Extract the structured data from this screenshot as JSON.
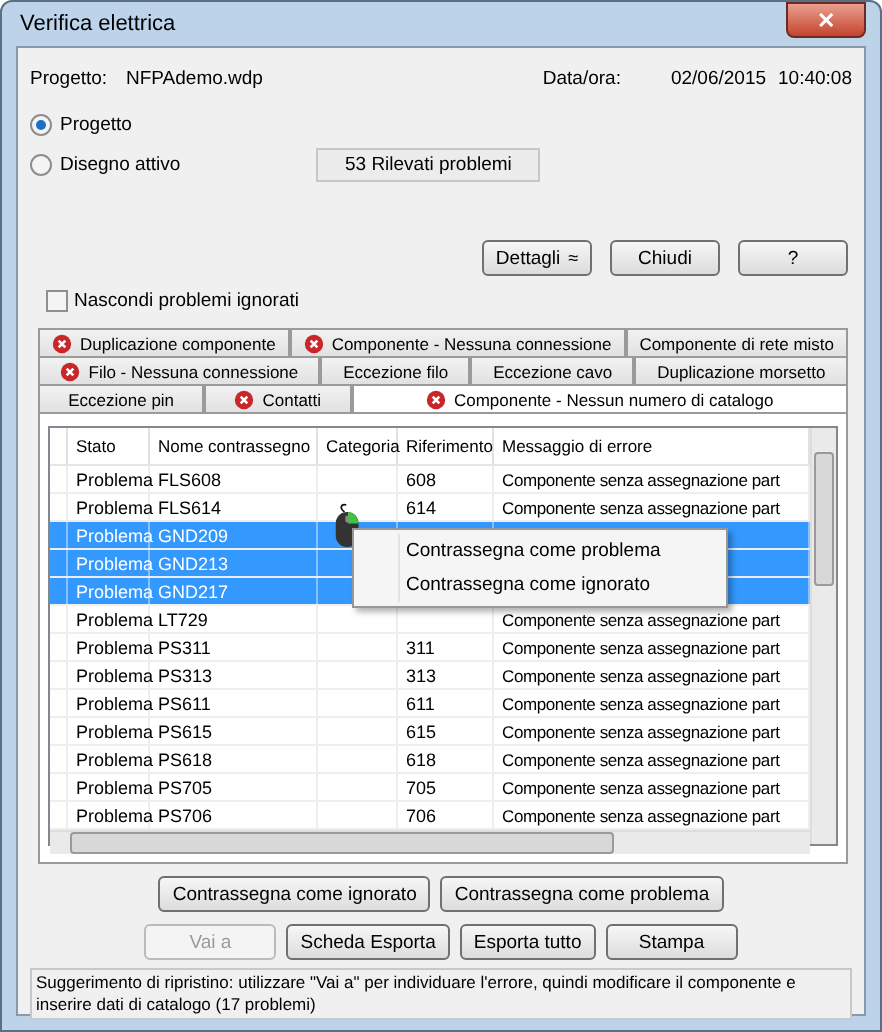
{
  "window": {
    "title": "Verifica elettrica",
    "close": "✕"
  },
  "project": {
    "label": "Progetto:",
    "value": "NFPAdemo.wdp",
    "date_label": "Data/ora:",
    "date": "02/06/2015",
    "time": "10:40:08"
  },
  "scope": [
    {
      "label": "Progetto",
      "selected": true
    },
    {
      "label": "Disegno attivo",
      "selected": false
    }
  ],
  "summary": "53 Rilevati problemi",
  "top_buttons": [
    {
      "label": "Dettagli",
      "kind": "details",
      "icon": "≈"
    },
    {
      "label": "Chiudi",
      "kind": "plain"
    },
    {
      "label": "?",
      "kind": "plain"
    }
  ],
  "hide_ignored": {
    "label": "Nascondi problemi ignorati",
    "checked": false
  },
  "tab_rows": [
    [
      {
        "label": "Duplicazione componente",
        "error": true,
        "selected": false
      },
      {
        "label": "Componente - Nessuna connessione",
        "error": true,
        "selected": false
      },
      {
        "label": "Componente di rete misto",
        "error": false,
        "selected": false
      }
    ],
    [
      {
        "label": "Filo - Nessuna connessione",
        "error": true,
        "selected": false
      },
      {
        "label": "Eccezione filo",
        "error": false,
        "selected": false
      },
      {
        "label": "Eccezione cavo",
        "error": false,
        "selected": false
      },
      {
        "label": "Duplicazione morsetto",
        "error": false,
        "selected": false
      }
    ],
    [
      {
        "label": "Eccezione pin",
        "error": false,
        "selected": false
      },
      {
        "label": "Contatti",
        "error": true,
        "selected": false
      },
      {
        "label": "Componente - Nessun numero di catalogo",
        "error": true,
        "selected": true
      }
    ]
  ],
  "table": {
    "columns": [
      "Stato",
      "Nome contrassegno",
      "Categoria",
      "Riferimento",
      "Messaggio di errore"
    ],
    "rows": [
      {
        "status": "Problema",
        "name": "FLS608",
        "ref": "608",
        "message": "Componente senza assegnazione part",
        "selected": false
      },
      {
        "status": "Problema",
        "name": "FLS614",
        "ref": "614",
        "message": "Componente senza assegnazione part",
        "selected": false
      },
      {
        "status": "Problema",
        "name": "GND209",
        "selected": true
      },
      {
        "status": "Problema",
        "name": "GND213",
        "selected": true
      },
      {
        "status": "Problema",
        "name": "GND217",
        "selected": true
      },
      {
        "status": "Problema",
        "name": "LT729",
        "message": "Componente senza assegnazione part",
        "selected": false
      },
      {
        "status": "Problema",
        "name": "PS311",
        "ref": "311",
        "message": "Componente senza assegnazione part",
        "selected": false
      },
      {
        "status": "Problema",
        "name": "PS313",
        "ref": "313",
        "message": "Componente senza assegnazione part",
        "selected": false
      },
      {
        "status": "Problema",
        "name": "PS611",
        "ref": "611",
        "message": "Componente senza assegnazione part",
        "selected": false
      },
      {
        "status": "Problema",
        "name": "PS615",
        "ref": "615",
        "message": "Componente senza assegnazione part",
        "selected": false
      },
      {
        "status": "Problema",
        "name": "PS618",
        "ref": "618",
        "message": "Componente senza assegnazione part",
        "selected": false
      },
      {
        "status": "Problema",
        "name": "PS705",
        "ref": "705",
        "message": "Componente senza assegnazione part",
        "selected": false
      },
      {
        "status": "Problema",
        "name": "PS706",
        "ref": "706",
        "message": "Componente senza assegnazione part",
        "selected": false
      }
    ]
  },
  "context_menu": [
    "Contrassegna come problema",
    "Contrassegna come ignorato"
  ],
  "mark_buttons": [
    "Contrassegna come ignorato",
    "Contrassegna come problema"
  ],
  "action_buttons": [
    {
      "label": "Vai a",
      "disabled": true
    },
    {
      "label": "Scheda Esporta",
      "disabled": false
    },
    {
      "label": "Esporta tutto",
      "disabled": false
    },
    {
      "label": "Stampa",
      "disabled": false
    }
  ],
  "hint": "Suggerimento di ripristino: utilizzare \"Vai a\" per individuare l'errore, quindi modificare il componente e inserire dati di catalogo (17 problemi)"
}
